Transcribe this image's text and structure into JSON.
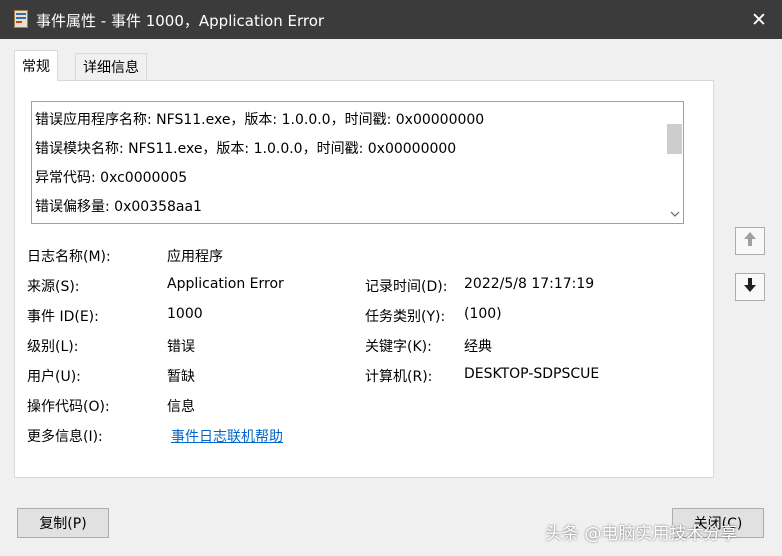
{
  "window": {
    "title": "事件属性 - 事件 1000，Application Error",
    "close_glyph": "✕"
  },
  "tabs": [
    {
      "label": "常规",
      "active": true
    },
    {
      "label": "详细信息",
      "active": false
    }
  ],
  "description": {
    "lines": [
      "错误应用程序名称: NFS11.exe，版本: 1.0.0.0，时间戳: 0x00000000",
      "错误模块名称: NFS11.exe，版本: 1.0.0.0，时间戳: 0x00000000",
      "异常代码: 0xc0000005",
      "错误偏移量: 0x00358aa1"
    ]
  },
  "fields": {
    "log_name": {
      "label": "日志名称(M):",
      "value": "应用程序"
    },
    "source": {
      "label": "来源(S):",
      "value": "Application Error"
    },
    "logged": {
      "label": "记录时间(D):",
      "value": "2022/5/8 17:17:19"
    },
    "event_id": {
      "label": "事件 ID(E):",
      "value": "1000"
    },
    "task_category": {
      "label": "任务类别(Y):",
      "value": "(100)"
    },
    "level": {
      "label": "级别(L):",
      "value": "错误"
    },
    "keywords": {
      "label": "关键字(K):",
      "value": "经典"
    },
    "user": {
      "label": "用户(U):",
      "value": "暂缺"
    },
    "computer": {
      "label": "计算机(R):",
      "value": "DESKTOP-SDPSCUE"
    },
    "opcode": {
      "label": "操作代码(O):",
      "value": "信息"
    },
    "more_info": {
      "label": "更多信息(I):",
      "value": "事件日志联机帮助"
    }
  },
  "buttons": {
    "copy": "复制(P)",
    "close": "关闭(C)"
  },
  "icons": {
    "app": "event-properties-icon",
    "up": "arrow-up-icon",
    "down": "arrow-down-icon"
  },
  "colors": {
    "titlebar": "#3b3b3b",
    "link": "#0066cc"
  },
  "watermark": "头条 @电脑实用技术分享"
}
